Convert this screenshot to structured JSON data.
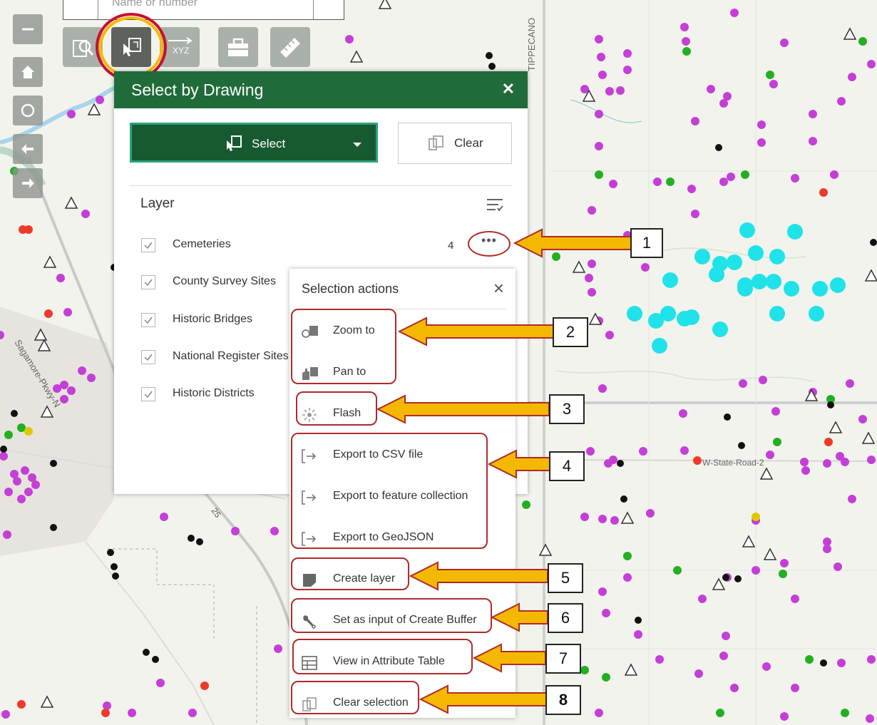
{
  "search": {
    "placeholder": "Name or number"
  },
  "map_labels": {
    "road_tippecanoe": "TIPPECANO",
    "road_sagamore": "Sagamore-Pkwy-N",
    "road_state": "W-State-Road-2",
    "route_25": "25"
  },
  "toolbar": {
    "tools": [
      "search-features-icon",
      "select-by-drawing-icon",
      "xyz-coordinates-icon",
      "toolbox-icon",
      "measure-ruler-icon"
    ],
    "active": "select-by-drawing-icon"
  },
  "panel": {
    "title": "Select by Drawing",
    "select_label": "Select",
    "clear_label": "Clear",
    "layer_header": "Layer",
    "layers": [
      {
        "name": "Cemeteries",
        "checked": true,
        "count": "4"
      },
      {
        "name": "County Survey Sites",
        "checked": true
      },
      {
        "name": "Historic Bridges",
        "checked": true
      },
      {
        "name": "National Register Sites",
        "checked": true
      },
      {
        "name": "Historic Districts",
        "checked": true
      }
    ],
    "more_label": "•••"
  },
  "selection_actions": {
    "title": "Selection actions",
    "items": [
      {
        "label": "Zoom to",
        "icon": "zoom-to-icon"
      },
      {
        "label": "Pan to",
        "icon": "pan-to-icon"
      },
      {
        "label": "Flash",
        "icon": "flash-icon"
      },
      {
        "label": "Export to CSV file",
        "icon": "export-icon"
      },
      {
        "label": "Export to feature collection",
        "icon": "export-icon"
      },
      {
        "label": "Export to GeoJSON",
        "icon": "export-icon"
      },
      {
        "label": "Create layer",
        "icon": "create-layer-icon"
      },
      {
        "label": "Set as input of Create Buffer",
        "icon": "wrench-icon"
      },
      {
        "label": "View in Attribute Table",
        "icon": "table-icon"
      },
      {
        "label": "Clear selection",
        "icon": "clear-selection-icon"
      }
    ]
  },
  "callouts": [
    "1",
    "2",
    "3",
    "4",
    "5",
    "6",
    "7",
    "8"
  ],
  "colors": {
    "header_green": "#1f6c3a",
    "select_green": "#175a31",
    "highlight_red": "#b02a2a",
    "arrow_fill": "#f5b800",
    "point_purple": "#c43fd6",
    "point_cyan": "#1fe3e8",
    "point_green": "#22b022",
    "point_red": "#ef3a2a"
  }
}
